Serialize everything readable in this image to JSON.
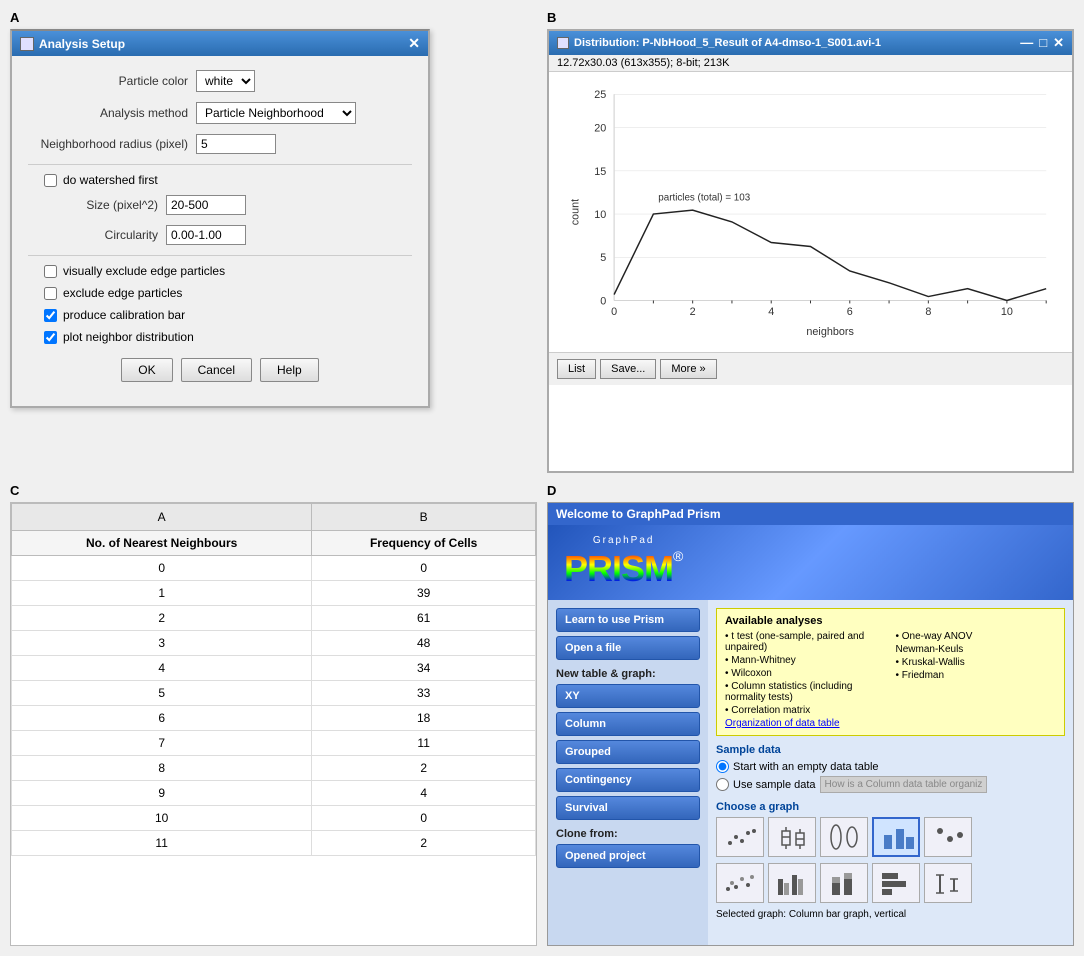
{
  "labels": {
    "A": "A",
    "B": "B",
    "C": "C",
    "D": "D"
  },
  "panelA": {
    "windowTitle": "Analysis Setup",
    "closeBtn": "✕",
    "particleColorLabel": "Particle color",
    "particleColorValue": "white",
    "analysisMethodLabel": "Analysis method",
    "analysisMethodValue": "Particle Neighborhood",
    "neighborhoodRadiusLabel": "Neighborhood radius (pixel)",
    "neighborhoodRadiusValue": "5",
    "watershedLabel": "do watershed first",
    "sizeLabel": "Size (pixel^2)",
    "sizeValue": "20-500",
    "circularityLabel": "Circularity",
    "circularityValue": "0.00-1.00",
    "excludeEdgeVisualLabel": "visually exclude edge particles",
    "excludeEdgeLabel": "exclude edge particles",
    "calibrationBarLabel": "produce calibration bar",
    "plotNeighborLabel": "plot neighbor distribution",
    "okBtn": "OK",
    "cancelBtn": "Cancel",
    "helpBtn": "Help"
  },
  "panelB": {
    "windowTitle": "Distribution: P-NbHood_5_Result of A4-dmso-1_S001.avi-1",
    "chartInfo": "12.72x30.03  (613x355); 8-bit; 213K",
    "particlesTotal": "particles (total) = 103",
    "yAxisLabel": "count",
    "xAxisLabel": "neighbors",
    "yAxisMax": 25,
    "yAxisTicks": [
      0,
      5,
      10,
      15,
      20,
      25
    ],
    "xAxisTicks": [
      0,
      2,
      4,
      6,
      8,
      10
    ],
    "listBtn": "List",
    "saveBtn": "Save...",
    "moreBtn": "More »"
  },
  "panelC": {
    "colA": "A",
    "colB": "B",
    "headerRow": [
      "No. of Nearest Neighbours",
      "Frequency of Cells"
    ],
    "rows": [
      [
        0,
        0
      ],
      [
        1,
        39
      ],
      [
        2,
        61
      ],
      [
        3,
        48
      ],
      [
        4,
        34
      ],
      [
        5,
        33
      ],
      [
        6,
        18
      ],
      [
        7,
        11
      ],
      [
        8,
        2
      ],
      [
        9,
        4
      ],
      [
        10,
        0
      ],
      [
        11,
        2
      ]
    ]
  },
  "panelD": {
    "windowTitle": "Welcome to GraphPad Prism",
    "graphpadText": "GraphPad",
    "prismText": "PRISM",
    "regMark": "®",
    "navButtons": [
      "Learn to use Prism",
      "Open a file"
    ],
    "newTableLabel": "New table & graph:",
    "tableButtons": [
      "XY",
      "Column",
      "Grouped",
      "Contingency",
      "Survival"
    ],
    "cloneFromLabel": "Clone from:",
    "cloneButtons": [
      "Opened project"
    ],
    "availableAnalysesTitle": "Available analyses",
    "analyses": {
      "col1": [
        "• t test (one-sample, paired and unpaired)",
        "• Mann-Whitney",
        "• Wilcoxon",
        "• Column statistics (including normality tests)",
        "• Correlation matrix"
      ],
      "col2": [
        "• One-way ANOV",
        "Newman-Keuls",
        "• Kruskal-Wallis",
        "• Friedman"
      ]
    },
    "orgLink": "Organization of data table",
    "sampleDataTitle": "Sample data",
    "radioEmpty": "Start with an empty data table",
    "radioSample": "Use sample data",
    "howLink": "How is a Column data table organiz",
    "chooseGraphTitle": "Choose a graph",
    "selectedGraphLabel": "Selected graph:  Column bar graph, vertical"
  }
}
